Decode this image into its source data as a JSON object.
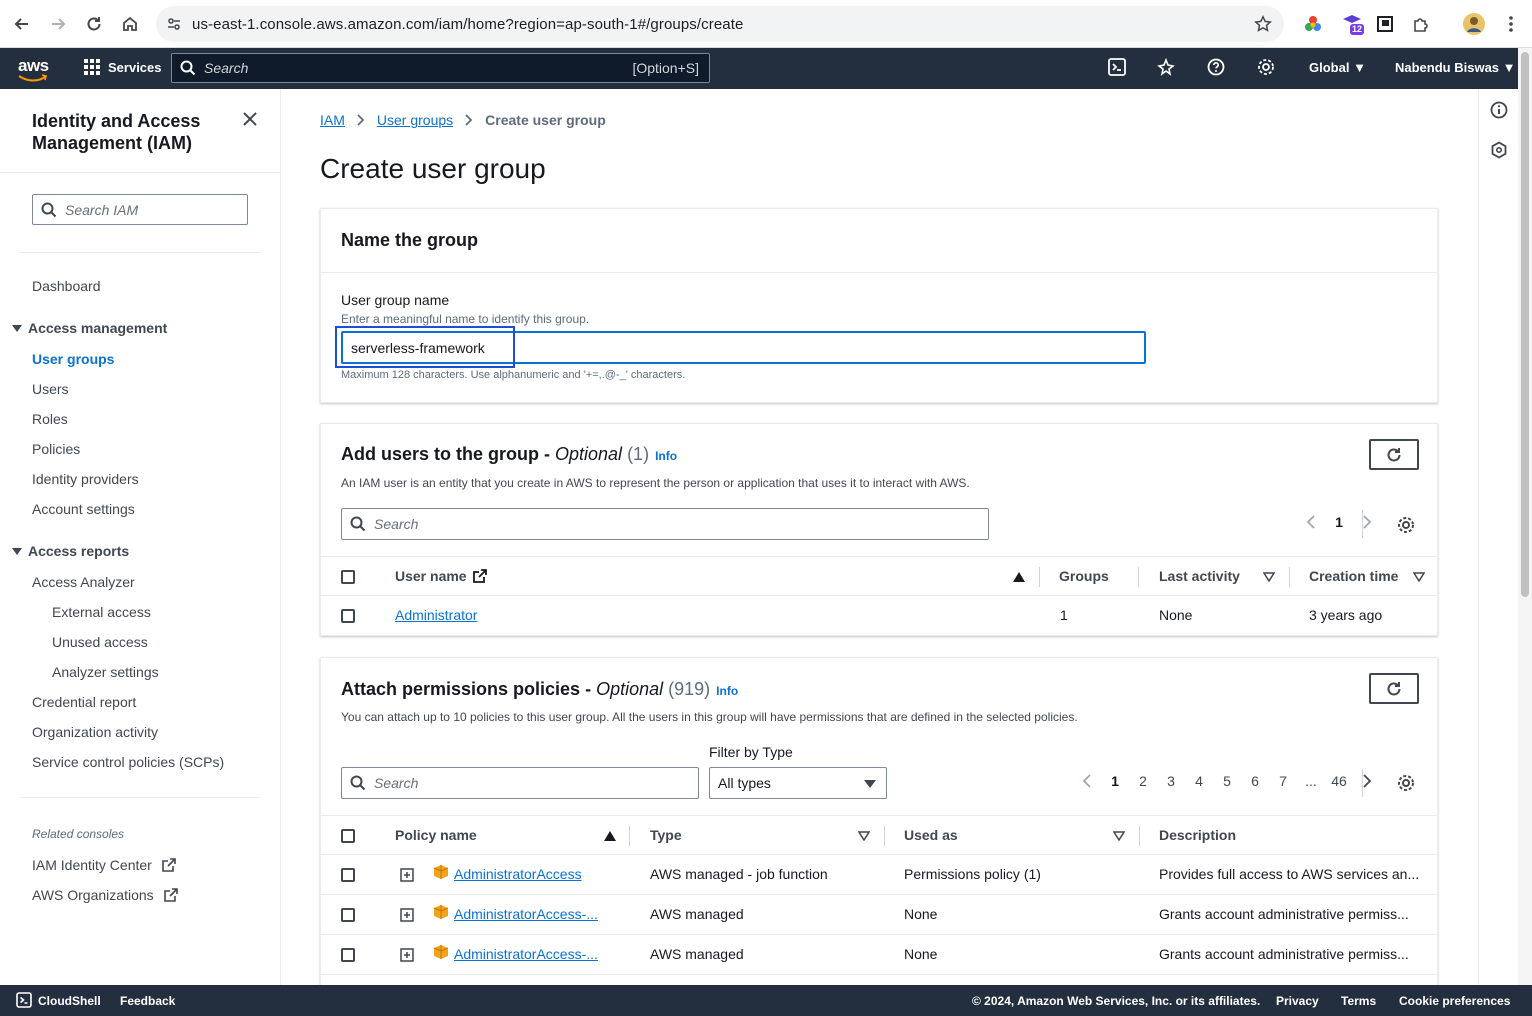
{
  "browser": {
    "url": "us-east-1.console.aws.amazon.com/iam/home?region=ap-south-1#/groups/create",
    "ext_badge": "12"
  },
  "topnav": {
    "logo": "aws",
    "services": "Services",
    "search_placeholder": "Search",
    "search_shortcut": "[Option+S]",
    "region": "Global",
    "user": "Nabendu Biswas"
  },
  "sidebar": {
    "title": "Identity and Access Management (IAM)",
    "search_placeholder": "Search IAM",
    "dashboard": "Dashboard",
    "access_management": "Access management",
    "am_items": [
      "User groups",
      "Users",
      "Roles",
      "Policies",
      "Identity providers",
      "Account settings"
    ],
    "access_reports": "Access reports",
    "ar_items": [
      "Access Analyzer",
      "External access",
      "Unused access",
      "Analyzer settings",
      "Credential report",
      "Organization activity",
      "Service control policies (SCPs)"
    ],
    "related_label": "Related consoles",
    "related": [
      "IAM Identity Center",
      "AWS Organizations"
    ]
  },
  "breadcrumb": {
    "items": [
      "IAM",
      "User groups",
      "Create user group"
    ]
  },
  "page": {
    "title": "Create user group"
  },
  "name_card": {
    "heading": "Name the group",
    "label": "User group name",
    "description": "Enter a meaningful name to identify this group.",
    "value": "serverless-framework",
    "constraint": "Maximum 128 characters. Use alphanumeric and '+=,.@-_' characters."
  },
  "users_card": {
    "title": "Add users to the group - ",
    "optional": "Optional",
    "count": "(1)",
    "info": "Info",
    "description": "An IAM user is an entity that you create in AWS to represent the person or application that uses it to interact with AWS.",
    "search_placeholder": "Search",
    "page": "1",
    "columns": [
      "User name",
      "Groups",
      "Last activity",
      "Creation time"
    ],
    "rows": [
      {
        "name": "Administrator",
        "groups": "1",
        "last_activity": "None",
        "created": "3 years ago"
      }
    ]
  },
  "policies_card": {
    "title": "Attach permissions policies - ",
    "optional": "Optional",
    "count": "(919)",
    "info": "Info",
    "description": "You can attach up to 10 policies to this user group. All the users in this group will have permissions that are defined in the selected policies.",
    "filter_label": "Filter by Type",
    "filter_value": "All types",
    "search_placeholder": "Search",
    "pages": [
      "1",
      "2",
      "3",
      "4",
      "5",
      "6",
      "7",
      "...",
      "46"
    ],
    "columns": [
      "Policy name",
      "Type",
      "Used as",
      "Description"
    ],
    "rows": [
      {
        "name": "AdministratorAccess",
        "type": "AWS managed - job function",
        "used_as": "Permissions policy (1)",
        "description": "Provides full access to AWS services an..."
      },
      {
        "name": "AdministratorAccess-...",
        "type": "AWS managed",
        "used_as": "None",
        "description": "Grants account administrative permiss..."
      },
      {
        "name": "AdministratorAccess-...",
        "type": "AWS managed",
        "used_as": "None",
        "description": "Grants account administrative permiss..."
      }
    ]
  },
  "footer": {
    "cloudshell": "CloudShell",
    "feedback": "Feedback",
    "copyright": "© 2024, Amazon Web Services, Inc. or its affiliates.",
    "privacy": "Privacy",
    "terms": "Terms",
    "cookies": "Cookie preferences"
  },
  "colors": {
    "accent": "#0972d3",
    "nav_bg": "#232f3e",
    "highlight": "#1d4ed8"
  }
}
